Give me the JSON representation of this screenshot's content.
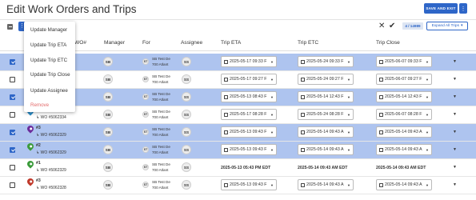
{
  "window": {
    "title": "Edit Work Orders and Trips",
    "save_label": "SAVE AND EXIT",
    "more_label": "⋮"
  },
  "toolbar": {
    "count": "4 / 14989",
    "expand_label": "Expand All Trips"
  },
  "columns": {
    "wo": "WO#",
    "manager": "Manager",
    "for": "For",
    "assignee": "Assignee",
    "trip_eta": "Trip ETA",
    "trip_etc": "Trip ETC",
    "trip_close": "Trip Close"
  },
  "menu": {
    "items": [
      {
        "label": "Update Manager"
      },
      {
        "label": "Update Trip ETA"
      },
      {
        "label": "Update Trip ETC"
      },
      {
        "label": "Update Trip Close"
      },
      {
        "label": "Update Assignee"
      },
      {
        "label": "Remove"
      }
    ]
  },
  "rows": [
    {
      "selected": true,
      "wo_num": "",
      "wo": "",
      "pin_color": "",
      "manager": "SB",
      "for_badge": "ST",
      "for_line1": "SB Test De",
      "for_line2": "700 Atlant",
      "assignee": "SS",
      "eta": "2025-05-17 09:33 F",
      "etc": "2025-05-24 09:33 F",
      "close": "2025-06-07 09:33 F"
    },
    {
      "selected": false,
      "wo_num": "",
      "wo": "",
      "pin_color": "",
      "manager": "SB",
      "for_badge": "ST",
      "for_line1": "SB Test De",
      "for_line2": "700 Atlant",
      "assignee": "SS",
      "eta": "2025-05-17 09:27 F",
      "etc": "2025-05-24 09:27 F",
      "close": "2025-06-07 09:27 F"
    },
    {
      "selected": true,
      "wo_num": "",
      "wo": "",
      "pin_color": "",
      "manager": "SB",
      "for_badge": "ST",
      "for_line1": "SB Test De",
      "for_line2": "700 Atlant",
      "assignee": "SS",
      "eta": "2025-05-13 08:43 F",
      "etc": "2025-05-14 12:43 F",
      "close": "2025-05-14 12:43 F"
    },
    {
      "selected": false,
      "wo_num": "#1",
      "wo": "WO #5062334",
      "pin_color": "#2a8cc7",
      "manager": "SB",
      "for_badge": "ST",
      "for_line1": "SB Test De",
      "for_line2": "700 Atlant",
      "assignee": "SS",
      "eta": "2025-05-17 08:28 F",
      "etc": "2025-05-24 08:28 F",
      "close": "2025-06-07 08:28 F"
    },
    {
      "selected": true,
      "wo_num": "#3",
      "wo": "WO #5062329",
      "pin_color": "#6c2d9b",
      "manager": "SB",
      "for_badge": "ST",
      "for_line1": "SB Test De",
      "for_line2": "700 Atlant",
      "assignee": "SS",
      "eta": "2025-05-13 09:43 F",
      "etc": "2025-05-14 09:43 A",
      "close": "2025-05-14 09:43 A"
    },
    {
      "selected": true,
      "wo_num": "#2",
      "wo": "WO #5062329",
      "pin_color": "#3c9b3c",
      "manager": "SB",
      "for_badge": "ST",
      "for_line1": "SB Test De",
      "for_line2": "700 Atlant",
      "assignee": "SS",
      "eta": "2025-05-13 09:43 F",
      "etc": "2025-05-14 09:43 A",
      "close": "2025-05-14 09:43 A"
    },
    {
      "selected": false,
      "wo_num": "#1",
      "wo": "WO #5062329",
      "pin_color": "#3c9b3c",
      "manager": "SB",
      "for_badge": "ST",
      "for_line1": "SB Test De",
      "for_line2": "700 Atlant",
      "assignee": "SS",
      "eta_text": "2025-05-13 05:43 PM EDT",
      "etc_text": "2025-05-14 09:43 AM EDT",
      "close_text": "2025-05-14 09:43 AM EDT"
    },
    {
      "selected": false,
      "wo_num": "#3",
      "wo": "WO #5062328",
      "pin_color": "#c0392b",
      "manager": "SB",
      "for_badge": "ST",
      "for_line1": "SB Test De",
      "for_line2": "700 Atlant",
      "assignee": "SS",
      "eta": "2025-05-13 09:43 F",
      "etc": "2025-05-14 09:43 A",
      "close": "2025-05-14 09:43 A"
    }
  ]
}
